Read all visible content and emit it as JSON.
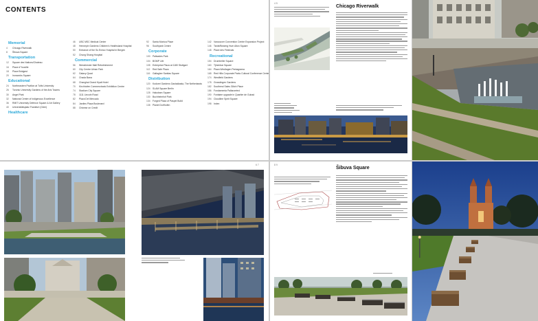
{
  "contents": {
    "title": "CONTENTS",
    "columns": [
      {
        "groups": [
          {
            "heading": "Memorial",
            "items": [
              {
                "num": "4",
                "label": "Chicago Riverwalk"
              },
              {
                "num": "8",
                "label": "Šibuva Square"
              }
            ]
          },
          {
            "heading": "Transportation",
            "items": [
              {
                "num": "12",
                "label": "Square des Nations/Chateau"
              },
              {
                "num": "16",
                "label": "Place d'Youville"
              },
              {
                "num": "18",
                "label": "Place Bridgest"
              },
              {
                "num": "20",
                "label": "Ironworks Square"
              }
            ]
          },
          {
            "heading": "Educational",
            "items": [
              {
                "num": "24",
                "label": "Northeastern Pavilion at Tufts University"
              },
              {
                "num": "26",
                "label": "Toronto University Gardens of the Arts Towers"
              },
              {
                "num": "30",
                "label": "Angel Park"
              },
              {
                "num": "32",
                "label": "National Centre of Indigenous Excellence"
              },
              {
                "num": "36",
                "label": "RMIT University Defence Square & Art Gallery"
              },
              {
                "num": "40",
                "label": "Universitätsplatz Frankfurt (Oder)"
              }
            ]
          },
          {
            "heading": "Healthcare",
            "items": []
          }
        ]
      },
      {
        "groups": [
          {
            "heading": "",
            "items": [
              {
                "num": "46",
                "label": "UBC MSC Medical Center"
              },
              {
                "num": "48",
                "label": "Hennepin Gardens Children's Healthsland Hospital"
              },
              {
                "num": "50",
                "label": "Entrance of the Ss Enrico Hospital in Bergen"
              },
              {
                "num": "52",
                "label": "Chung Shang Hospital"
              }
            ]
          },
          {
            "heading": "Commercial",
            "items": [
              {
                "num": "56",
                "label": "Westchester Mall Refurbishment"
              },
              {
                "num": "60",
                "label": "City Centre Urban Park"
              },
              {
                "num": "62",
                "label": "Galaxy Quad"
              },
              {
                "num": "64",
                "label": "Chada Bana"
              },
              {
                "num": "68",
                "label": "Changhai Grand Hyatt Hotel"
              },
              {
                "num": "70",
                "label": "Kirchhofen Commerzbank Exhibition Centre"
              },
              {
                "num": "74",
                "label": "Stadium City Square"
              },
              {
                "num": "78",
                "label": "1111 Lincoln Road"
              },
              {
                "num": "82",
                "label": "Plaza Del Mercado"
              },
              {
                "num": "84",
                "label": "Jardins Plaza Boulevard"
              },
              {
                "num": "88",
                "label": "Chinese on Credit"
              }
            ]
          }
        ]
      },
      {
        "groups": [
          {
            "heading": "",
            "items": [
              {
                "num": "92",
                "label": "Santa Monica Place"
              },
              {
                "num": "96",
                "label": "Southpark Centre"
              }
            ]
          },
          {
            "heading": "Corporate",
            "items": [
              {
                "num": "100",
                "label": "Palisades Park"
              },
              {
                "num": "104",
                "label": "BGMP Life"
              },
              {
                "num": "108",
                "label": "Enterprise Plaza at 1180 Stuttgart"
              },
              {
                "num": "112",
                "label": "Red Safe Plaza"
              },
              {
                "num": "116",
                "label": "Gallagher Sanitas Square"
              }
            ]
          },
          {
            "heading": "Distribution",
            "items": [
              {
                "num": "120",
                "label": "Kodorei Gardens Gashaliwala, The Netherlands"
              },
              {
                "num": "124",
                "label": "SLAM Square Berlin"
              },
              {
                "num": "128",
                "label": "Hakobam Square"
              },
              {
                "num": "130",
                "label": "Buchheimhof Park"
              },
              {
                "num": "134",
                "label": "Forged Plaza of Paspel Build"
              },
              {
                "num": "138",
                "label": "Planet Dorfhofen"
              }
            ]
          }
        ]
      },
      {
        "groups": [
          {
            "heading": "",
            "items": [
              {
                "num": "142",
                "label": "Vancouver Convention Centre Expansion Project"
              },
              {
                "num": "146",
                "label": "Tarde/Bearing Hum Alton Square"
              },
              {
                "num": "148",
                "label": "Place des Festivals"
              }
            ]
          },
          {
            "heading": "Recreational",
            "items": [
              {
                "num": "154",
                "label": "Drumheller Square"
              },
              {
                "num": "160",
                "label": "Tjinenbar Square"
              },
              {
                "num": "164",
                "label": "Plaza Windlagen Pentagrama"
              },
              {
                "num": "168",
                "label": "Red Hills Corporate Parks Cultural Conference Center"
              },
              {
                "num": "174",
                "label": "Westfield Gardens"
              },
              {
                "num": "178",
                "label": "Grosslingen Gardens"
              },
              {
                "num": "182",
                "label": "Southend Sales Glitch Place"
              },
              {
                "num": "186",
                "label": "Fondamenta Pallanzeted"
              },
              {
                "num": "190",
                "label": "Fontaine upgrade in Quartier de Gulrad"
              },
              {
                "num": "194",
                "label": "Cloudline Spirit Square"
              },
              {
                "num": "198",
                "label": "Index"
              }
            ]
          }
        ]
      }
    ]
  },
  "articles": {
    "riverwalk": {
      "title": "Chicago Riverwalk",
      "page": "4 5"
    },
    "sibuva": {
      "title": "Šibuva Square",
      "page": "8 9"
    }
  },
  "spread_bottom_left": {
    "page": "6 7"
  },
  "colors": {
    "accent": "#2aa7d8",
    "background": "#c9c9c9",
    "page": "#ffffff"
  }
}
